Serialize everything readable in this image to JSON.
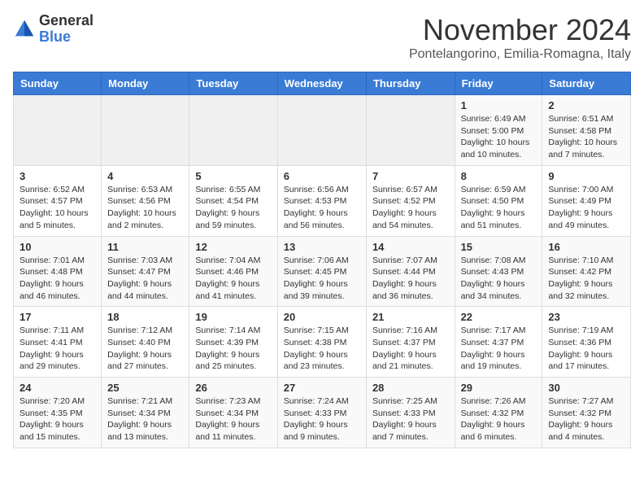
{
  "header": {
    "logo_general": "General",
    "logo_blue": "Blue",
    "month_title": "November 2024",
    "location": "Pontelangorino, Emilia-Romagna, Italy"
  },
  "days_of_week": [
    "Sunday",
    "Monday",
    "Tuesday",
    "Wednesday",
    "Thursday",
    "Friday",
    "Saturday"
  ],
  "weeks": [
    [
      {
        "day": "",
        "info": ""
      },
      {
        "day": "",
        "info": ""
      },
      {
        "day": "",
        "info": ""
      },
      {
        "day": "",
        "info": ""
      },
      {
        "day": "",
        "info": ""
      },
      {
        "day": "1",
        "info": "Sunrise: 6:49 AM\nSunset: 5:00 PM\nDaylight: 10 hours and 10 minutes."
      },
      {
        "day": "2",
        "info": "Sunrise: 6:51 AM\nSunset: 4:58 PM\nDaylight: 10 hours and 7 minutes."
      }
    ],
    [
      {
        "day": "3",
        "info": "Sunrise: 6:52 AM\nSunset: 4:57 PM\nDaylight: 10 hours and 5 minutes."
      },
      {
        "day": "4",
        "info": "Sunrise: 6:53 AM\nSunset: 4:56 PM\nDaylight: 10 hours and 2 minutes."
      },
      {
        "day": "5",
        "info": "Sunrise: 6:55 AM\nSunset: 4:54 PM\nDaylight: 9 hours and 59 minutes."
      },
      {
        "day": "6",
        "info": "Sunrise: 6:56 AM\nSunset: 4:53 PM\nDaylight: 9 hours and 56 minutes."
      },
      {
        "day": "7",
        "info": "Sunrise: 6:57 AM\nSunset: 4:52 PM\nDaylight: 9 hours and 54 minutes."
      },
      {
        "day": "8",
        "info": "Sunrise: 6:59 AM\nSunset: 4:50 PM\nDaylight: 9 hours and 51 minutes."
      },
      {
        "day": "9",
        "info": "Sunrise: 7:00 AM\nSunset: 4:49 PM\nDaylight: 9 hours and 49 minutes."
      }
    ],
    [
      {
        "day": "10",
        "info": "Sunrise: 7:01 AM\nSunset: 4:48 PM\nDaylight: 9 hours and 46 minutes."
      },
      {
        "day": "11",
        "info": "Sunrise: 7:03 AM\nSunset: 4:47 PM\nDaylight: 9 hours and 44 minutes."
      },
      {
        "day": "12",
        "info": "Sunrise: 7:04 AM\nSunset: 4:46 PM\nDaylight: 9 hours and 41 minutes."
      },
      {
        "day": "13",
        "info": "Sunrise: 7:06 AM\nSunset: 4:45 PM\nDaylight: 9 hours and 39 minutes."
      },
      {
        "day": "14",
        "info": "Sunrise: 7:07 AM\nSunset: 4:44 PM\nDaylight: 9 hours and 36 minutes."
      },
      {
        "day": "15",
        "info": "Sunrise: 7:08 AM\nSunset: 4:43 PM\nDaylight: 9 hours and 34 minutes."
      },
      {
        "day": "16",
        "info": "Sunrise: 7:10 AM\nSunset: 4:42 PM\nDaylight: 9 hours and 32 minutes."
      }
    ],
    [
      {
        "day": "17",
        "info": "Sunrise: 7:11 AM\nSunset: 4:41 PM\nDaylight: 9 hours and 29 minutes."
      },
      {
        "day": "18",
        "info": "Sunrise: 7:12 AM\nSunset: 4:40 PM\nDaylight: 9 hours and 27 minutes."
      },
      {
        "day": "19",
        "info": "Sunrise: 7:14 AM\nSunset: 4:39 PM\nDaylight: 9 hours and 25 minutes."
      },
      {
        "day": "20",
        "info": "Sunrise: 7:15 AM\nSunset: 4:38 PM\nDaylight: 9 hours and 23 minutes."
      },
      {
        "day": "21",
        "info": "Sunrise: 7:16 AM\nSunset: 4:37 PM\nDaylight: 9 hours and 21 minutes."
      },
      {
        "day": "22",
        "info": "Sunrise: 7:17 AM\nSunset: 4:37 PM\nDaylight: 9 hours and 19 minutes."
      },
      {
        "day": "23",
        "info": "Sunrise: 7:19 AM\nSunset: 4:36 PM\nDaylight: 9 hours and 17 minutes."
      }
    ],
    [
      {
        "day": "24",
        "info": "Sunrise: 7:20 AM\nSunset: 4:35 PM\nDaylight: 9 hours and 15 minutes."
      },
      {
        "day": "25",
        "info": "Sunrise: 7:21 AM\nSunset: 4:34 PM\nDaylight: 9 hours and 13 minutes."
      },
      {
        "day": "26",
        "info": "Sunrise: 7:23 AM\nSunset: 4:34 PM\nDaylight: 9 hours and 11 minutes."
      },
      {
        "day": "27",
        "info": "Sunrise: 7:24 AM\nSunset: 4:33 PM\nDaylight: 9 hours and 9 minutes."
      },
      {
        "day": "28",
        "info": "Sunrise: 7:25 AM\nSunset: 4:33 PM\nDaylight: 9 hours and 7 minutes."
      },
      {
        "day": "29",
        "info": "Sunrise: 7:26 AM\nSunset: 4:32 PM\nDaylight: 9 hours and 6 minutes."
      },
      {
        "day": "30",
        "info": "Sunrise: 7:27 AM\nSunset: 4:32 PM\nDaylight: 9 hours and 4 minutes."
      }
    ]
  ]
}
